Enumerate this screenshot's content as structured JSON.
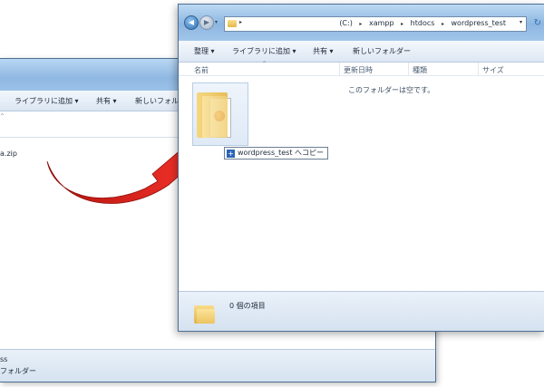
{
  "back_window": {
    "toolbar": {
      "library": "ライブラリに追加 ▾",
      "share": "共有 ▾",
      "new_folder": "新しいフォル"
    },
    "file_name": "a.zip",
    "status": {
      "line1": "ss",
      "line2": "フォルダー"
    }
  },
  "front_window": {
    "address": {
      "drive": "(C:)",
      "seg1": "xampp",
      "seg2": "htdocs",
      "seg3": "wordpress_test"
    },
    "toolbar": {
      "organize": "整理 ▾",
      "library": "ライブラリに追加 ▾",
      "share": "共有 ▾",
      "new_folder": "新しいフォルダー"
    },
    "columns": {
      "name": "名前",
      "date": "更新日時",
      "type": "種類",
      "size": "サイズ"
    },
    "empty_message": "このフォルダーは空です。",
    "drag_tooltip": "wordpress_test へコピー",
    "status": {
      "item_count": "0 個の項目"
    }
  },
  "colors": {
    "arrow": "#e8241c",
    "title_bar": "#8fb8e2",
    "accent": "#2b65b8"
  },
  "icons": [
    "folder-icon",
    "back-arrow-icon",
    "forward-arrow-icon",
    "refresh-icon",
    "plus-icon"
  ]
}
